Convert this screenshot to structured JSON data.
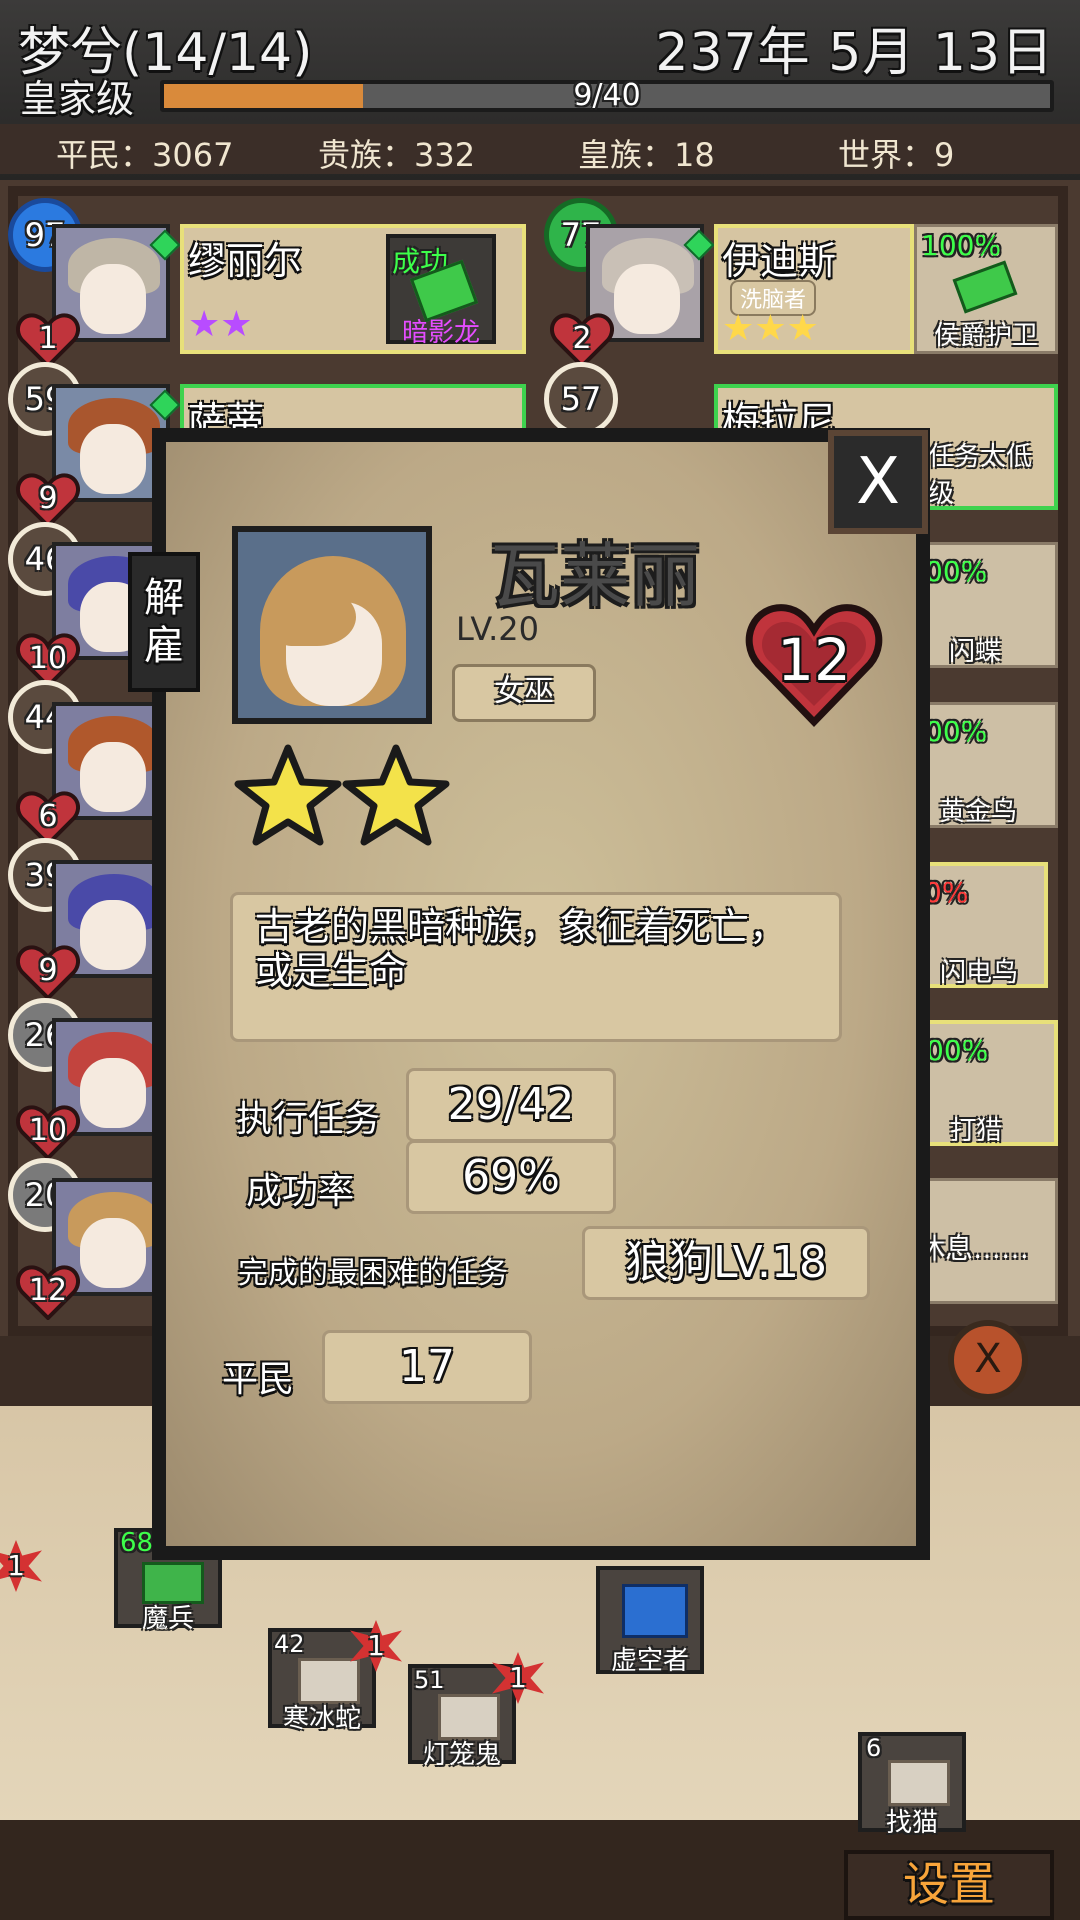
{
  "header": {
    "guild_name": "梦兮(14/14)",
    "date": "237年 5月 13日",
    "rank": "皇家级",
    "xp_text": "9/40",
    "xp_fraction": 0.225
  },
  "resources": {
    "commoners": "平民：3067",
    "nobles": "贵族：332",
    "royals": "皇族：18",
    "world": "世界：9"
  },
  "heroes": [
    {
      "level": "97",
      "hearts": "1",
      "name": "缪丽尔",
      "status": "成功",
      "task": "暗影龙",
      "stars": 2
    },
    {
      "level": "77",
      "hearts": "2",
      "name": "伊迪斯",
      "tag": "洗脑者",
      "percent": "100%",
      "task": "侯爵护卫",
      "stars": 3
    },
    {
      "level": "59",
      "hearts": "9",
      "name": "萨蒂"
    },
    {
      "level": "57",
      "hearts": "",
      "name": "梅拉尼",
      "note": "任务太低级"
    },
    {
      "level": "46",
      "hearts": "10"
    },
    {
      "level": "44",
      "hearts": "6"
    },
    {
      "level": "39",
      "hearts": "9"
    },
    {
      "level": "26",
      "hearts": "10"
    },
    {
      "level": "20",
      "hearts": "12"
    }
  ],
  "right_tasks": [
    {
      "percent": "00%",
      "task": "闪蝶"
    },
    {
      "percent": "00%",
      "task": "黄金鸟"
    },
    {
      "percent": "0%",
      "task": "闪电鸟"
    },
    {
      "percent": "00%",
      "task": "打猎"
    },
    {
      "note": "休息……"
    }
  ],
  "modal": {
    "close_label": "X",
    "dismiss_label": "解雇",
    "hero_name": "瓦莱丽",
    "level": "LV.20",
    "class": "女巫",
    "hearts": "12",
    "stars": 2,
    "description": "古老的黑暗种族，象征着死亡，或是生命",
    "stats": {
      "missions_label": "执行任务",
      "missions_value": "29/42",
      "success_label": "成功率",
      "success_value": "69%",
      "hardest_label": "完成的最困难的任务",
      "hardest_value": "狼狗LV.18",
      "class_label": "平民",
      "class_value": "17"
    }
  },
  "floor_items": [
    {
      "count": "68",
      "label": "魔兵",
      "color": "#3fb44a"
    },
    {
      "count": "",
      "label": "虚空者",
      "color": "#2b6fd1"
    },
    {
      "count": "42",
      "label": "寒冰蛇",
      "badge": "1",
      "color": "#d8d0c2"
    },
    {
      "count": "51",
      "label": "灯笼鬼",
      "badge": "1",
      "color": "#d8d0c2"
    },
    {
      "count": "6",
      "label": "找猫",
      "color": "#d8d0c2"
    }
  ],
  "edge_badge": "1",
  "settings_label": "设置",
  "colors": {
    "accent_orange": "#d98a3b",
    "green": "#3dff4a",
    "gold": "#ffd84a",
    "purple": "#b84cff",
    "heart_red": "#c0343c"
  }
}
